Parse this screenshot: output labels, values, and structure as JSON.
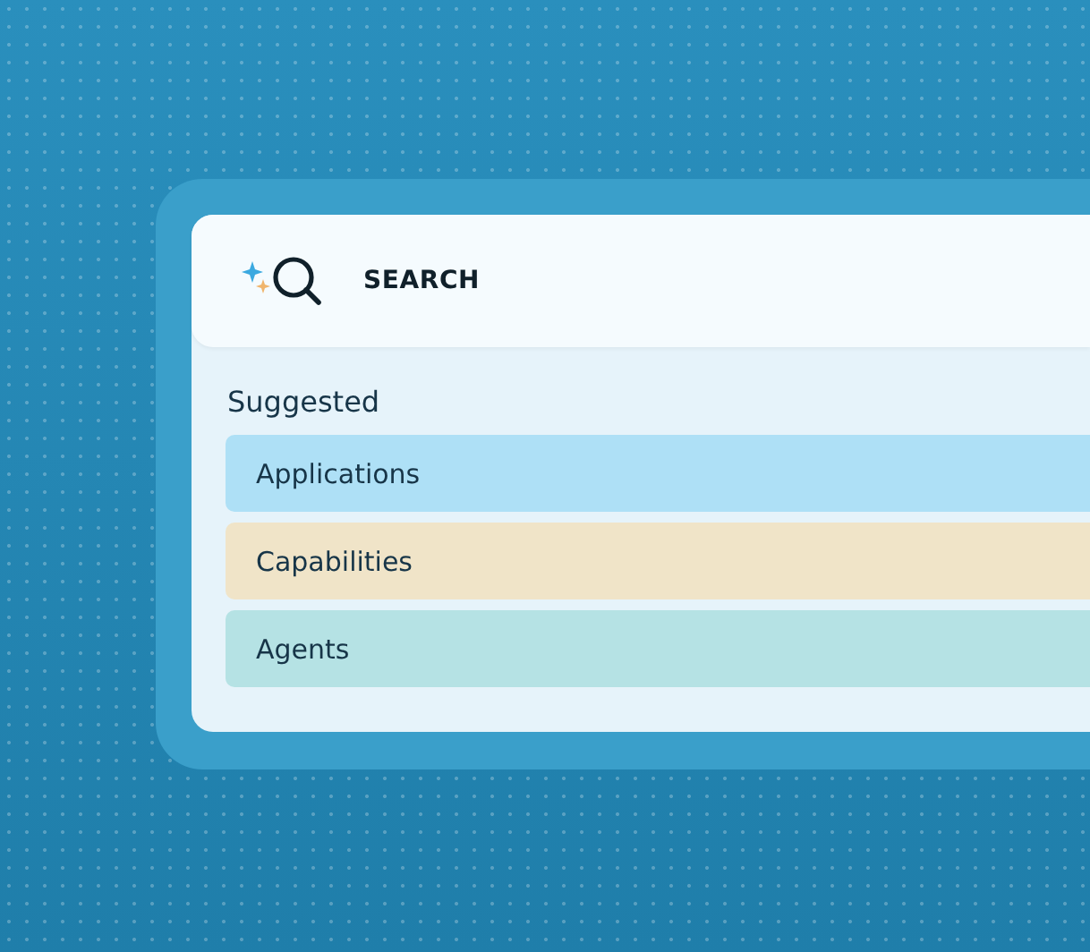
{
  "search": {
    "label": "SEARCH"
  },
  "suggested": {
    "heading": "Suggested",
    "items": [
      {
        "label": "Applications",
        "color": "#aee0f6"
      },
      {
        "label": "Capabilities",
        "color": "#f0e4c8"
      },
      {
        "label": "Agents",
        "color": "#b5e2e4"
      }
    ]
  }
}
